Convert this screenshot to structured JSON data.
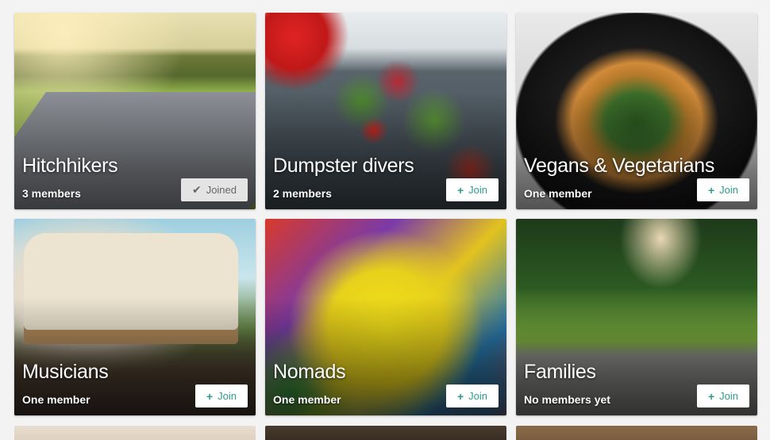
{
  "groups": [
    {
      "title": "Hitchhikers",
      "members": "3 members",
      "button": {
        "label": "Joined",
        "state": "joined",
        "icon": "checkmark-icon",
        "glyph": "✔"
      }
    },
    {
      "title": "Dumpster divers",
      "members": "2 members",
      "button": {
        "label": "Join",
        "state": "join",
        "icon": "plus-icon",
        "glyph": "+"
      }
    },
    {
      "title": "Vegans & Vegetarians",
      "members": "One member",
      "button": {
        "label": "Join",
        "state": "join",
        "icon": "plus-icon",
        "glyph": "+"
      }
    },
    {
      "title": "Musicians",
      "members": "One member",
      "button": {
        "label": "Join",
        "state": "join",
        "icon": "plus-icon",
        "glyph": "+"
      }
    },
    {
      "title": "Nomads",
      "members": "One member",
      "button": {
        "label": "Join",
        "state": "join",
        "icon": "plus-icon",
        "glyph": "+"
      }
    },
    {
      "title": "Families",
      "members": "No members yet",
      "button": {
        "label": "Join",
        "state": "join",
        "icon": "plus-icon",
        "glyph": "+"
      }
    }
  ],
  "colors": {
    "accent": "#2a9d8f",
    "page_background": "#f3f3f3",
    "joined_button": "#e4e4e4"
  }
}
